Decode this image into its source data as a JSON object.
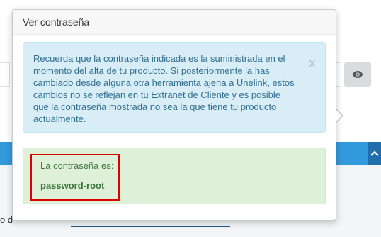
{
  "popover": {
    "title": "Ver contraseña",
    "info": {
      "text": "Recuerda que la contraseña indicada es la suministrada en el momento del alta de tu producto. Si posteriormente la has cambiado desde alguna otra herramienta ajena a Unelink, estos cambios no se reflejan en tu Extranet de Cliente y es posible que la contraseña mostrada no sea la que tiene tu producto actualmente.",
      "close_label": "x"
    },
    "password": {
      "label": "La contraseña es:",
      "value": "password-root"
    }
  },
  "background": {
    "fragment_text": "o d",
    "eye_icon": "eye-icon",
    "up_icon": "chevron-up-icon"
  },
  "colors": {
    "info_bg": "#d9edf7",
    "info_text": "#31708f",
    "success_bg": "#dff0d8",
    "success_text": "#3c763d",
    "highlight_border": "#dd0000",
    "accent_blue": "#3399dd"
  }
}
